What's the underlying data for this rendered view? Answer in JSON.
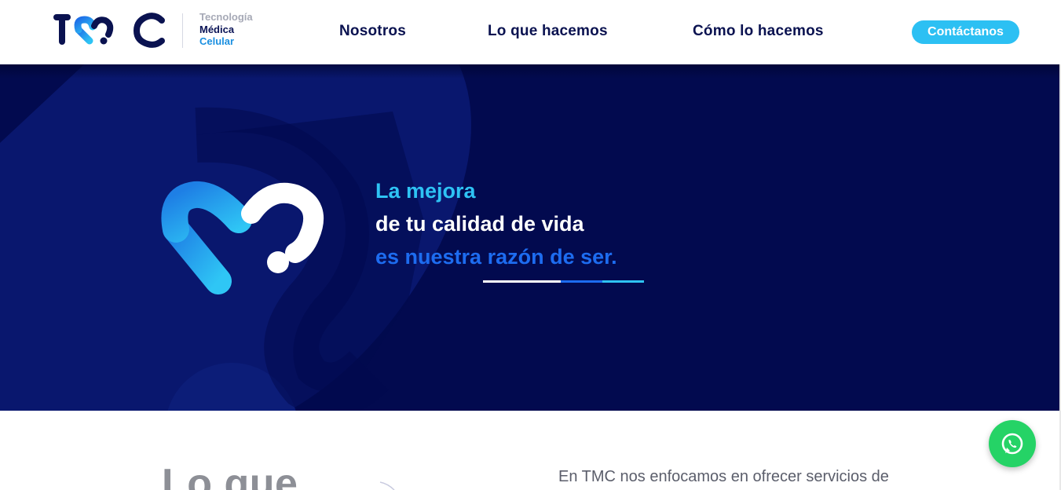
{
  "header": {
    "logo_name": "TMC",
    "tagline": [
      "Tecnología",
      "Médica",
      "Celular"
    ],
    "nav": [
      {
        "label": "Nosotros"
      },
      {
        "label": "Lo que hacemos"
      },
      {
        "label": "Cómo lo hacemos"
      }
    ],
    "cta_label": "Contáctanos"
  },
  "hero": {
    "line1": "La mejora",
    "line2": "de tu calidad de vida",
    "line3": "es nuestra razón de ser.",
    "icon": "tmc-heart-mark-icon"
  },
  "section": {
    "title": "Lo que",
    "text": "En TMC nos enfocamos en ofrecer servicios de"
  },
  "whatsapp": {
    "icon": "whatsapp-icon"
  },
  "colors": {
    "navy": "#020a4f",
    "brand_dark": "#0a1250",
    "cyan": "#2ec3f4",
    "blue": "#1d6cf0",
    "whatsapp": "#25d366"
  }
}
